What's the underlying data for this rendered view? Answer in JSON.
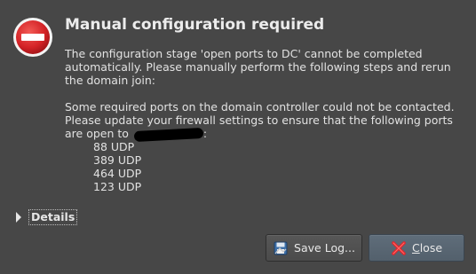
{
  "dialog": {
    "title": "Manual configuration required",
    "paragraph1": "The configuration stage 'open ports to DC' cannot be completed automatically. Please manually perform the following steps and rerun the domain join:",
    "paragraph2_line1": "Some required ports on the domain controller could not be contacted.",
    "paragraph2_line2": "Please update your firewall settings to ensure that the following ports",
    "paragraph2_line3_prefix": "are open to ",
    "paragraph2_line3_suffix": ":",
    "ports": [
      "88  UDP",
      "389 UDP",
      "464 UDP",
      "123 UDP"
    ],
    "details_label": "Details",
    "save_log_label": "Save Log...",
    "close_label_first": "C",
    "close_label_rest": "lose"
  },
  "icons": {
    "stop": "stop-icon",
    "save_log": "save-log-icon",
    "close": "close-icon"
  },
  "colors": {
    "background": "#474747",
    "stop_red": "#d8282a",
    "close_x": "#e0242b"
  }
}
